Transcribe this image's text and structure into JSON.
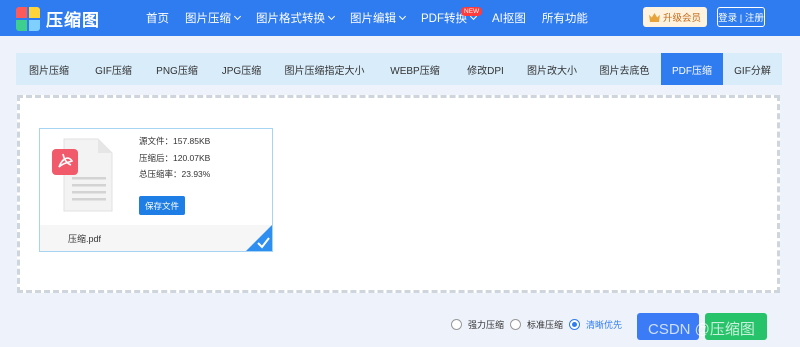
{
  "header": {
    "logo_text": "压缩图",
    "nav": [
      {
        "label": "首页",
        "dropdown": false
      },
      {
        "label": "图片压缩",
        "dropdown": true
      },
      {
        "label": "图片格式转换",
        "dropdown": true
      },
      {
        "label": "图片编辑",
        "dropdown": true
      },
      {
        "label": "PDF转换",
        "dropdown": true,
        "badge": "NEW"
      },
      {
        "label": "AI抠图",
        "dropdown": false
      },
      {
        "label": "所有功能",
        "dropdown": false
      }
    ],
    "vip_label": "升级会员",
    "login_label": "登录 | 注册"
  },
  "tabs": [
    {
      "label": "图片压缩",
      "active": false
    },
    {
      "label": "GIF压缩",
      "active": false
    },
    {
      "label": "PNG压缩",
      "active": false
    },
    {
      "label": "JPG压缩",
      "active": false
    },
    {
      "label": "图片压缩指定大小",
      "active": false
    },
    {
      "label": "WEBP压缩",
      "active": false
    },
    {
      "label": "修改DPI",
      "active": false
    },
    {
      "label": "图片改大小",
      "active": false
    },
    {
      "label": "图片去底色",
      "active": false
    },
    {
      "label": "PDF压缩",
      "active": true
    },
    {
      "label": "GIF分解",
      "active": false
    }
  ],
  "file": {
    "source_size": "源文件：157.85KB",
    "compressed_size": "压缩后：120.07KB",
    "ratio": "总压缩率：23.93%",
    "save_label": "保存文件",
    "filename": "压缩.pdf"
  },
  "options": {
    "items": [
      {
        "label": "强力压缩",
        "selected": false
      },
      {
        "label": "标准压缩",
        "selected": false
      },
      {
        "label": "清晰优先",
        "selected": true
      }
    ]
  },
  "watermark": "CSDN @压缩图",
  "colors": {
    "accent": "#2f7bf0",
    "tab_bg": "#d8ecfa",
    "pdf_red": "#f05a6a",
    "green": "#27c36b"
  }
}
